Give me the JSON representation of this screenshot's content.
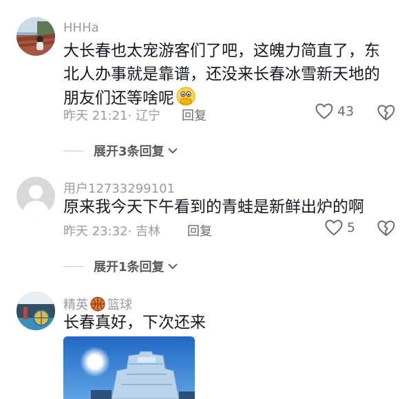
{
  "comments": [
    {
      "username": "HHHa",
      "text": "大长春也太宠游客们了吧，这魄力简直了，东北人办事就是靠谱，还没来长春冰雪新天地的朋友们还等啥呢",
      "time": "昨天 21:21",
      "location": "辽宁",
      "reply_label": "回复",
      "likes": "43",
      "expand_label": "展开3条回复",
      "avatar_icon": "avatar-photo-rooftop",
      "emoji": "face-with-hand-over-mouth"
    },
    {
      "username": "用户12733299101",
      "text": "原来我今天下午看到的青蛙是新鲜出炉的啊",
      "time": "昨天 23:32",
      "location": "吉林",
      "reply_label": "回复",
      "likes": "5",
      "expand_label": "展开1条回复",
      "avatar_icon": "default-avatar-icon"
    },
    {
      "username_prefix": "精英",
      "username_suffix": "篮球",
      "username_icon": "basketball-icon",
      "text": "长春真好，下次还来",
      "avatar_icon": "avatar-photo-basketball",
      "photo_icon": "ice-castle-photo"
    }
  ],
  "colors": {
    "text_primary": "#161823",
    "text_secondary": "#9a9aa0",
    "reply_gray": "#6b6b70"
  },
  "icons": {
    "like": "heart-outline-icon",
    "dislike": "broken-heart-outline-icon",
    "expand": "chevron-down-icon"
  }
}
